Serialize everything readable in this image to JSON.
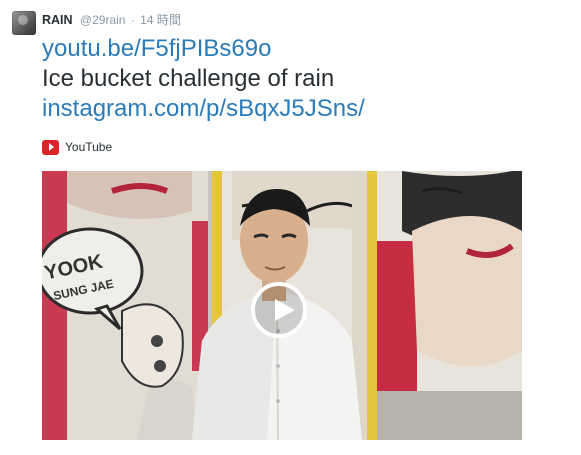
{
  "tweet": {
    "display_name": "RAIN",
    "handle": "@29rain",
    "separator": "·",
    "timestamp": "14 時間",
    "lines": [
      "youtu.be/F5fjPIBs69o",
      "Ice bucket challenge of rain",
      "instagram.com/p/sBqxJ5JSns/"
    ],
    "source_label": "YouTube",
    "video_sign_text": [
      "YOOK",
      "SUNG JAE"
    ]
  },
  "colors": {
    "link": "#2b7bb9",
    "text": "#292f33",
    "meta": "#8899a6",
    "youtube_red": "#d9252a"
  },
  "icons": {
    "avatar": "avatar",
    "source": "youtube-icon",
    "play": "play-icon"
  }
}
